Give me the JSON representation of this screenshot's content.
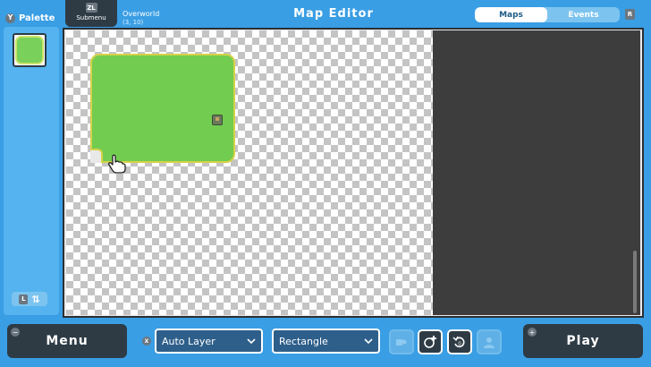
{
  "header": {
    "palette_key": "Y",
    "palette_label": "Palette",
    "submenu_key": "ZL",
    "submenu_label": "Submenu",
    "map_name": "Overworld",
    "map_coord": "(3, 10)",
    "title": "Map Editor",
    "tabs": [
      {
        "label": "Maps",
        "active": true
      },
      {
        "label": "Events",
        "active": false
      }
    ],
    "r_key": "R"
  },
  "palette": {
    "layer_key": "L",
    "swap_glyph": "⇅"
  },
  "bottom": {
    "menu_label": "Menu",
    "menu_key": "−",
    "play_label": "Play",
    "play_key": "+",
    "x_key": "X",
    "layer_select": "Auto Layer",
    "shape_select": "Rectangle"
  },
  "icons": {
    "palette_tile": "grass-tile-icon",
    "cursor": "hand-pointer-icon",
    "tools": [
      "fill-bucket-icon",
      "add-tile-icon",
      "undo-icon",
      "person-icon"
    ]
  },
  "colors": {
    "background": "#3a9ee4",
    "dark": "#2e3b45",
    "grass": "#72cc50",
    "grass_border": "#d6d24a",
    "canvas_dark": "#3d3d3d"
  }
}
